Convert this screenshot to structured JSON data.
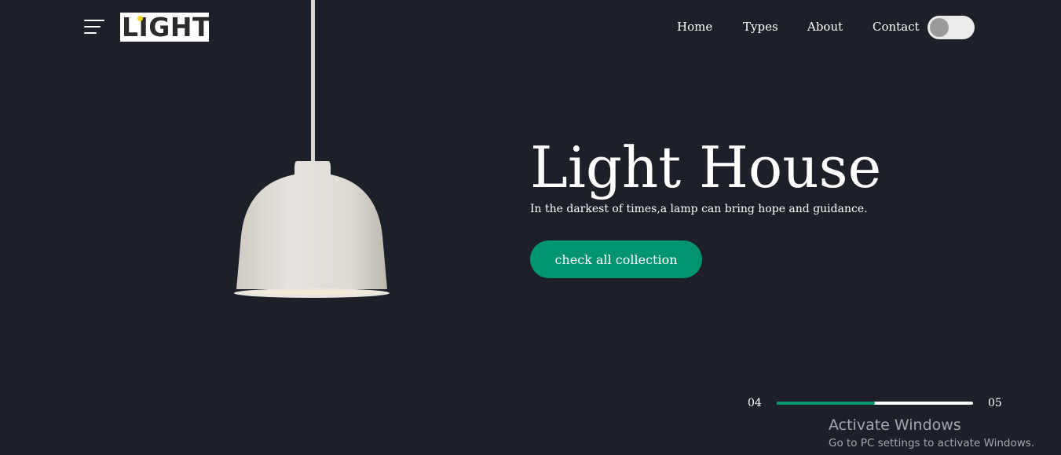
{
  "header": {
    "logo_text": "LIGHT",
    "nav": [
      {
        "label": "Home"
      },
      {
        "label": "Types"
      },
      {
        "label": "About"
      },
      {
        "label": "Contact"
      }
    ],
    "theme_toggle": {
      "on": false
    }
  },
  "hero": {
    "title": "Light House",
    "subtitle": "In the darkest of times,a lamp can bring hope and guidance.",
    "cta_label": "check all collection"
  },
  "slider": {
    "current": "04",
    "total": "05",
    "progress_fraction": 0.5
  },
  "watermark": {
    "title": "Activate Windows",
    "subtitle": "Go to PC settings to activate Windows."
  },
  "colors": {
    "background": "#1e2029",
    "accent": "#009570",
    "logo_dot": "#f2d62c"
  },
  "icons": {
    "menu": "hamburger-menu-icon",
    "hero_image": "pendant-lamp-image"
  }
}
